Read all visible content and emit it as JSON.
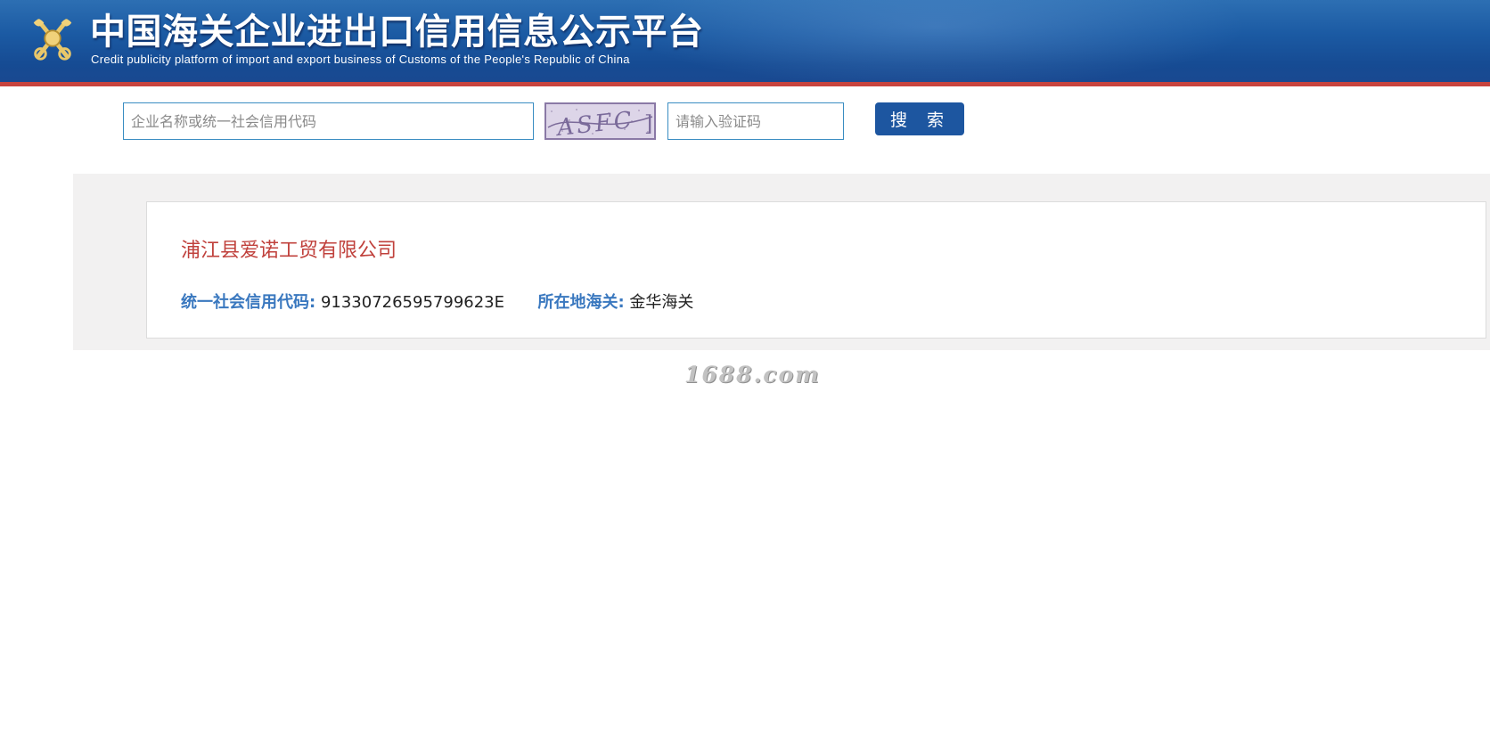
{
  "header": {
    "title_cn": "中国海关企业进出口信用信息公示平台",
    "title_en": "Credit publicity platform of import and export business of Customs of the People's Republic of China",
    "emblem_icon": "customs-emblem-icon",
    "colors": {
      "banner": "#1b5aa3",
      "accent_stripe": "#c8443e"
    }
  },
  "search": {
    "company_placeholder": "企业名称或统一社会信用代码",
    "company_value": "",
    "captcha_text": "ASFC",
    "captcha_placeholder": "请输入验证码",
    "captcha_value": "",
    "button_label": "搜 索"
  },
  "result": {
    "company_name": "浦江县爱诺工贸有限公司",
    "credit_code_label": "统一社会信用代码:",
    "credit_code_value": "91330726595799623E",
    "customs_label": "所在地海关:",
    "customs_value": "金华海关",
    "colors": {
      "company_name": "#c0413c",
      "label": "#3a78bf"
    }
  },
  "watermark": "1688.com"
}
